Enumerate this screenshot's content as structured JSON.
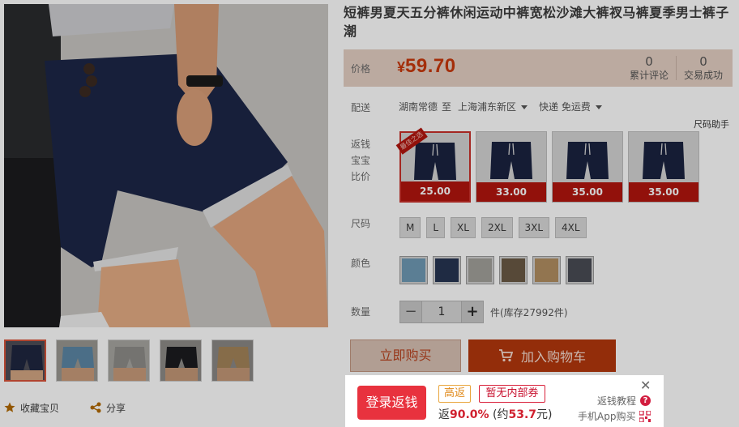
{
  "product": {
    "title": "短裤男夏天五分裤休闲运动中裤宽松沙滩大裤衩马裤夏季男士裤子潮"
  },
  "price": {
    "label": "价格",
    "currency": "¥",
    "amount": "59.70",
    "color": "#c8390d"
  },
  "stats": {
    "reviews_count": "0",
    "reviews_label": "累计评论",
    "sales_count": "0",
    "sales_label": "交易成功"
  },
  "shipping": {
    "label": "配送",
    "from": "湖南常德",
    "to_word": "至",
    "destination": "上海浦东新区",
    "method": "快递",
    "fee": "免运费"
  },
  "size_helper": "尺码助手",
  "rebate_compare": {
    "label_lines": [
      "返钱",
      "宝宝",
      "比价"
    ],
    "items": [
      {
        "price": "25.00",
        "tag": "最佳之选"
      },
      {
        "price": "33.00"
      },
      {
        "price": "35.00"
      },
      {
        "price": "35.00"
      }
    ]
  },
  "sizes": {
    "label": "尺码",
    "options": [
      "M",
      "L",
      "XL",
      "2XL",
      "3XL",
      "4XL"
    ]
  },
  "colors": {
    "label": "颜色",
    "swatches": [
      "#6f9ab5",
      "#273552",
      "#a3a19c",
      "#6b5a45",
      "#b38f62",
      "#4a4c55"
    ]
  },
  "quantity": {
    "label": "数量",
    "minus": "−",
    "value": "1",
    "plus": "+",
    "stock": "件(库存27992件)"
  },
  "actions": {
    "buy_now": "立即购买",
    "add_cart": "加入购物车"
  },
  "footer": {
    "favorite": "收藏宝贝",
    "share": "分享"
  },
  "popup": {
    "login": "登录返钱",
    "tag_high": "高返",
    "tag_coupon": "暂无内部券",
    "rebate_prefix": "返",
    "rebate_percent": "90.0%",
    "approx_prefix": "(约",
    "approx_amount": "53.7",
    "approx_suffix": "元)",
    "close": "✕",
    "tutorial": "返钱教程",
    "mobile": "手机App购买",
    "accent": "#e8323e"
  }
}
